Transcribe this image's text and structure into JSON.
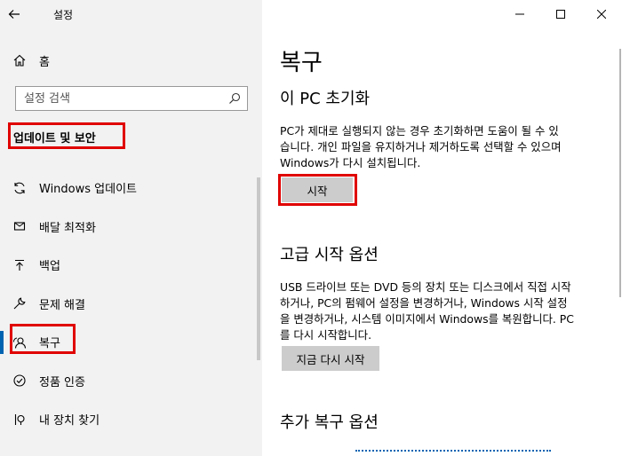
{
  "window": {
    "title": "설정"
  },
  "nav": {
    "home": "홈",
    "search_placeholder": "설정 검색",
    "section_title": "업데이트 및 보안",
    "items": [
      {
        "label": "Windows 업데이트",
        "icon": "sync-icon"
      },
      {
        "label": "배달 최적화",
        "icon": "delivery-icon"
      },
      {
        "label": "백업",
        "icon": "backup-icon"
      },
      {
        "label": "문제 해결",
        "icon": "wrench-icon"
      },
      {
        "label": "복구",
        "icon": "recovery-icon",
        "active": true
      },
      {
        "label": "정품 인증",
        "icon": "check-circle-icon"
      },
      {
        "label": "내 장치 찾기",
        "icon": "find-device-icon"
      }
    ]
  },
  "main": {
    "title": "복구",
    "reset": {
      "heading": "이 PC 초기화",
      "lines": [
        "PC가 제대로 실행되지 않는 경우 초기화하면 도움이 될 수 있",
        "습니다. 개인 파일을 유지하거나 제거하도록 선택할 수 있으며",
        "Windows가 다시 설치됩니다."
      ],
      "button": "시작"
    },
    "advanced": {
      "heading": "고급 시작 옵션",
      "lines": [
        "USB 드라이브 또는 DVD 등의 장치 또는 디스크에서 직접 시작",
        "하거나, PC의 펌웨어 설정을 변경하거나, Windows 시작 설정",
        "을 변경하거나, 시스템 이미지에서 Windows를 복원합니다. PC",
        "를 다시 시작합니다."
      ],
      "button": "지금 다시 시작"
    },
    "more": {
      "heading": "추가 복구 옵션"
    }
  },
  "colors": {
    "accent": "#0063b1",
    "highlight": "#e00000"
  }
}
